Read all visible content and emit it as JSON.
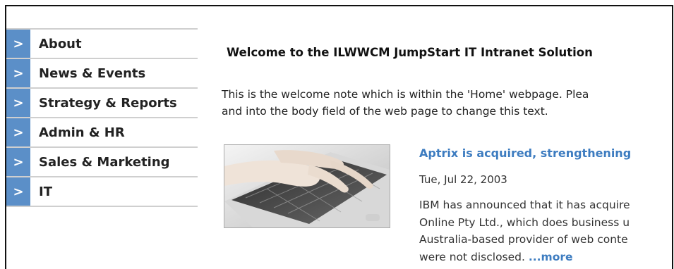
{
  "sidebar": {
    "items": [
      {
        "label": "About"
      },
      {
        "label": "News & Events"
      },
      {
        "label": "Strategy & Reports"
      },
      {
        "label": "Admin & HR"
      },
      {
        "label": "Sales & Marketing"
      },
      {
        "label": "IT"
      }
    ]
  },
  "main": {
    "welcome_title": "Welcome to the ILWWCM JumpStart IT Intranet Solution",
    "welcome_line1": "This is the welcome note which is within the 'Home' webpage. Plea",
    "welcome_line2": "and into the body field of the web page to change this text.",
    "news": {
      "title": "Aptrix is acquired, strengthening",
      "date": "Tue, Jul 22, 2003",
      "body_line1": "IBM has announced that it has acquire",
      "body_line2": "Online Pty Ltd., which does business u",
      "body_line3": "Australia-based provider of web conte",
      "body_line4": "were not disclosed.",
      "more": "...more"
    }
  },
  "colors": {
    "nav_accent": "#5b8fc8",
    "link": "#3d7cc0"
  }
}
